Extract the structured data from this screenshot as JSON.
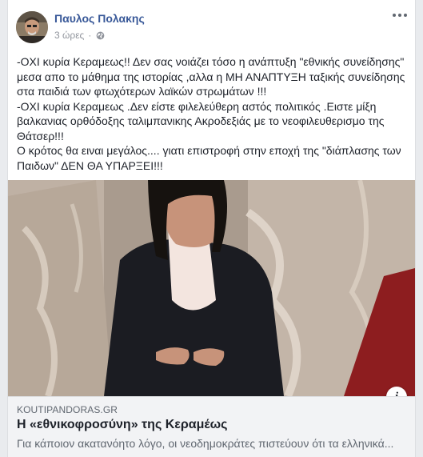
{
  "post": {
    "author": "Παυλος Πολακης",
    "time": "3 ώρες",
    "privacy_icon": "globe-icon",
    "more_icon": "more-options-icon",
    "lines": [
      "-ΟΧΙ κυρία Κεραμεως!! Δεν σας νοιάζει τόσο η ανάπτυξη \"εθνικής συνείδησης\"",
      "μεσα απο το μάθημα της ιστορίας ,αλλα η ΜΗ ΑΝΑΠΤΥΞΗ ταξικής συνείδησης",
      "στα παιδιά των φτωχότερων λαϊκών στρωμάτων !!!",
      "-ΟΧΙ κυρία Κεραμεως .Δεν είστε φιλελεύθερη αστός πολιτικός .Ειστε μίξη",
      "βαλκανιας ορθόδοξης ταλιμπανικης Ακροδεξιάς με το νεοφιλευθερισμο της",
      "Θάτσερ!!!",
      "Ο κρότος θα ειναι μεγάλος.... γιατι επιστροφή στην εποχή της \"διάπλασης των",
      "Παιδων\" ΔΕΝ ΘΑ ΥΠΑΡΞΕΙ!!!"
    ]
  },
  "link": {
    "domain": "KOUTIPANDORAS.GR",
    "title": "Η «εθνικοφροσύνη» της Κεραμέως",
    "description": "Για κάποιον ακατανόητο λόγο, οι νεοδημοκράτες πιστεύουν ότι τα ελληνικά...",
    "info_label": "i"
  }
}
